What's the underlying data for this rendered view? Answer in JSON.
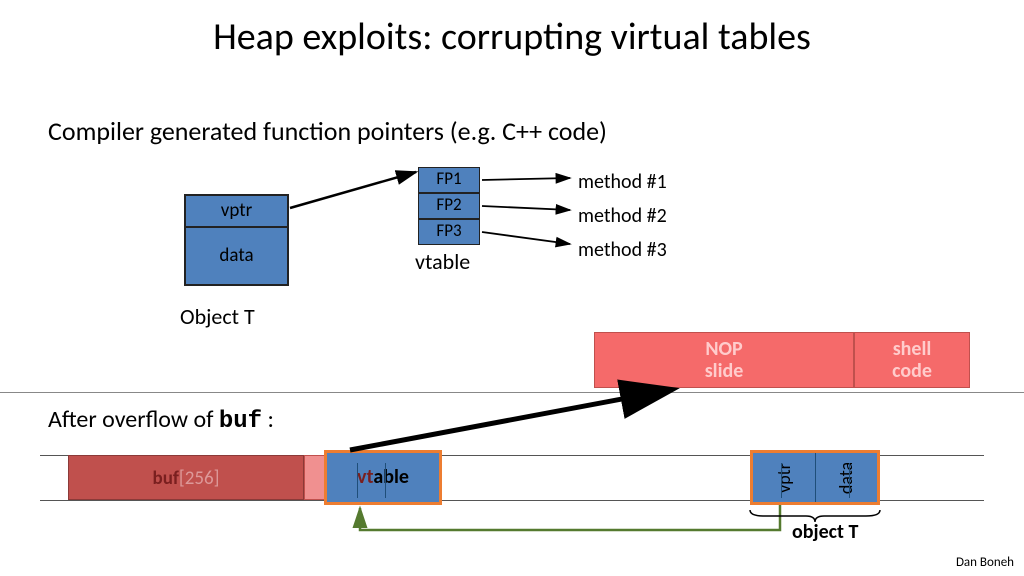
{
  "title": "Heap exploits:   corrupting virtual tables",
  "subtitle": "Compiler generated function pointers  (e.g.  C++ code)",
  "author": "Dan Boneh",
  "object_t": {
    "vptr": "vptr",
    "data": "data",
    "label": "Object  T"
  },
  "vtable": {
    "fp1": "FP1",
    "fp2": "FP2",
    "fp3": "FP3",
    "label": "vtable"
  },
  "methods": {
    "m1": "method #1",
    "m2": "method #2",
    "m3": "method #3"
  },
  "nop": {
    "slide_l1": "NOP",
    "slide_l2": "slide",
    "shell_l1": "shell",
    "shell_l2": "code"
  },
  "after_text": "After overflow of ",
  "after_code": "buf",
  "after_colon": " :",
  "buf": {
    "name": "buf",
    "size": "[256]"
  },
  "vtable2": {
    "pre": "vt",
    "post": "able"
  },
  "objT2": {
    "vptr": "vptr",
    "data": "data",
    "label": "object T"
  }
}
